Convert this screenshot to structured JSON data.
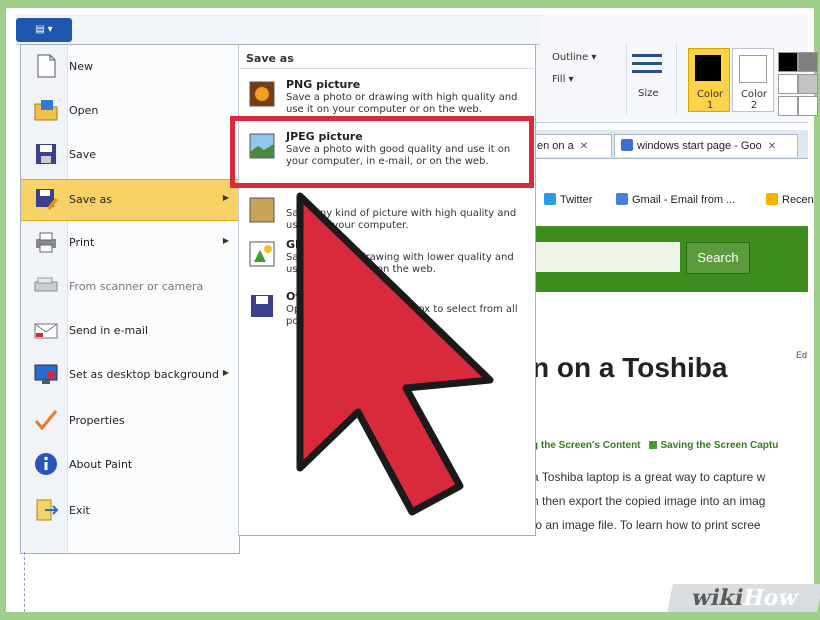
{
  "ribbon": {
    "outline_label": "Outline ▾",
    "fill_label": "Fill ▾",
    "size_label": "Size",
    "color1_label": "Color 1",
    "color2_label": "Color 2"
  },
  "browser": {
    "tabs": [
      {
        "label": "en on a",
        "close": "✕"
      },
      {
        "label": "windows start page - Goo",
        "close": "✕"
      }
    ],
    "bookmarks": [
      "Twitter",
      "Gmail - Email from ...",
      "Recen"
    ],
    "search_button": "Search",
    "article_title": "n on a Toshiba",
    "edit_label": "Ed",
    "breadcrumbs": [
      "g the Screen's Content",
      "Saving the Screen Captu"
    ],
    "paragraph_lines": [
      "a Toshiba laptop is a great way to capture w",
      "n then export the copied image into an imag",
      "to an image file. To learn how to print scree"
    ]
  },
  "paint_menu": {
    "left_items": [
      {
        "label": "New",
        "icon": "new-file-icon",
        "arrow": false,
        "disabled": false
      },
      {
        "label": "Open",
        "icon": "open-folder-icon",
        "arrow": false,
        "disabled": false
      },
      {
        "label": "Save",
        "icon": "save-disk-icon",
        "arrow": false,
        "disabled": false
      },
      {
        "label": "Save as",
        "icon": "save-as-icon",
        "arrow": true,
        "disabled": false,
        "active": true
      },
      {
        "label": "Print",
        "icon": "printer-icon",
        "arrow": true,
        "disabled": false
      },
      {
        "label": "From scanner or camera",
        "icon": "scanner-icon",
        "arrow": false,
        "disabled": true
      },
      {
        "label": "Send in e-mail",
        "icon": "email-icon",
        "arrow": false,
        "disabled": false
      },
      {
        "label": "Set as desktop background",
        "icon": "desktop-icon",
        "arrow": true,
        "disabled": false
      },
      {
        "label": "Properties",
        "icon": "checkmark-icon",
        "arrow": false,
        "disabled": false
      },
      {
        "label": "About Paint",
        "icon": "info-icon",
        "arrow": false,
        "disabled": false
      },
      {
        "label": "Exit",
        "icon": "exit-icon",
        "arrow": false,
        "disabled": false
      }
    ],
    "save_as_header": "Save as",
    "save_as_items": [
      {
        "title": "PNG picture",
        "desc": "Save a photo or drawing with high quality and use it on your computer or on the web."
      },
      {
        "title": "JPEG picture",
        "desc": "Save a photo with good quality and use it on your computer, in e-mail, or on the web."
      },
      {
        "title": "",
        "desc": "Save any kind of picture with high quality and use it on your computer."
      },
      {
        "title": "GIF",
        "desc": "Save a simple drawing with lower quality and use it in e-mail or on the web."
      },
      {
        "title": "Ot",
        "desc": "Open the Save As dialog box to select from all possible file types."
      }
    ]
  },
  "watermark": {
    "wiki": "wiki",
    "how": "How"
  },
  "colors": {
    "highlight": "#d82a3b",
    "arrow": "#d82a3b",
    "menu_active": "#f8d264"
  }
}
